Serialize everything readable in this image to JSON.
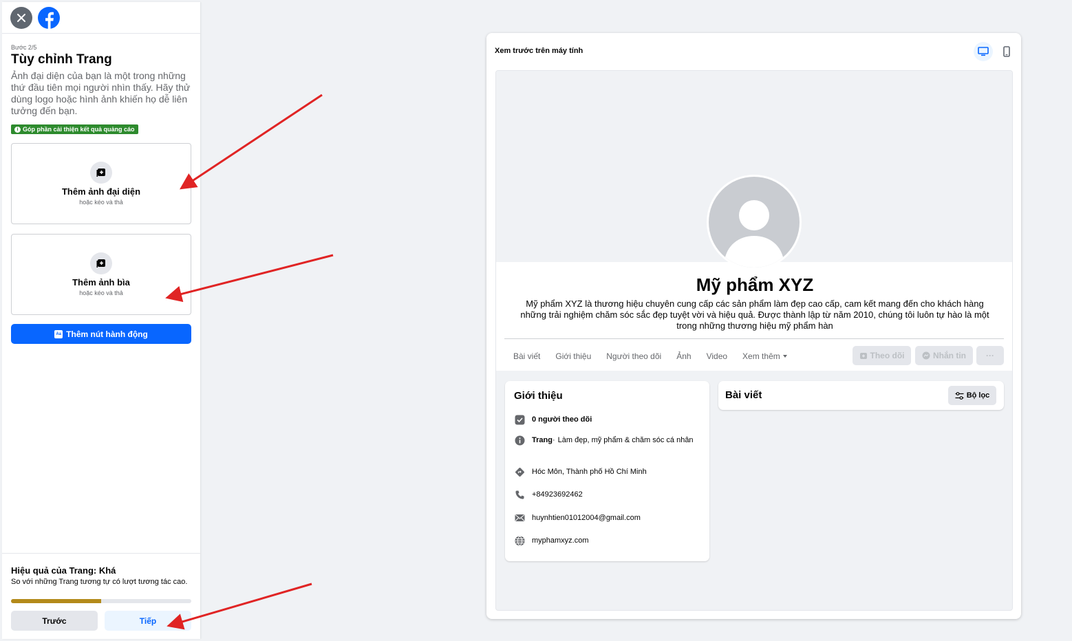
{
  "sidebar": {
    "step": "Bước 2/5",
    "title": "Tùy chỉnh Trang",
    "description": "Ảnh đại diện của bạn là một trong những thứ đầu tiên mọi người nhìn thấy. Hãy thử dùng logo hoặc hình ảnh khiến họ dễ liên tưởng đến bạn.",
    "badge": "Góp phần cải thiện kết quả quảng cáo",
    "avatar_upload": {
      "title": "Thêm ảnh đại diện",
      "subtitle": "hoặc kéo và thả"
    },
    "cover_upload": {
      "title": "Thêm ảnh bìa",
      "subtitle": "hoặc kéo và thả"
    },
    "action_button": "Thêm nút hành động",
    "action_icon_text": "Aa",
    "performance": {
      "title": "Hiệu quả của Trang: Khá",
      "description": "So với những Trang tương tự có lượt tương tác cao.",
      "progress_fraction": 0.5
    },
    "prev_label": "Trước",
    "next_label": "Tiếp"
  },
  "preview": {
    "header": "Xem trước trên máy tính",
    "page_name": "Mỹ phẩm XYZ",
    "page_description": "Mỹ phẩm XYZ là thương hiệu chuyên cung cấp các sản phẩm làm đẹp cao cấp, cam kết mang đến cho khách hàng những trải nghiệm chăm sóc sắc đẹp tuyệt vời và hiệu quả. Được thành lập từ năm 2010, chúng tôi luôn tự hào là một trong những thương hiệu mỹ phẩm hàn",
    "tabs": [
      "Bài viết",
      "Giới thiệu",
      "Người theo dõi",
      "Ảnh",
      "Video",
      "Xem thêm"
    ],
    "follow_label": "Theo dõi",
    "message_label": "Nhắn tin",
    "more_label": "···",
    "intro": {
      "title": "Giới thiệu",
      "followers": "0 người theo dõi",
      "category_label": "Trang",
      "category_sep": "·",
      "category": "Làm đẹp, mỹ phẩm & chăm sóc cá nhân",
      "location": "Hóc Môn, Thành phố Hồ Chí Minh",
      "phone": "+84923692462",
      "email": "huynhtien01012004@gmail.com",
      "website": "myphamxyz.com"
    },
    "posts": {
      "title": "Bài viết",
      "filter_label": "Bộ lọc"
    }
  },
  "colors": {
    "brand_blue": "#0866ff",
    "badge_green": "#2e8b2e",
    "annotation_red": "#e02424",
    "progress": "#b38a1a"
  },
  "icons": [
    "close-icon",
    "facebook-logo",
    "add-photo-icon",
    "desktop-icon",
    "mobile-icon",
    "checkbox-icon",
    "info-icon",
    "location-icon",
    "phone-icon",
    "email-icon",
    "globe-icon",
    "filter-icon"
  ]
}
